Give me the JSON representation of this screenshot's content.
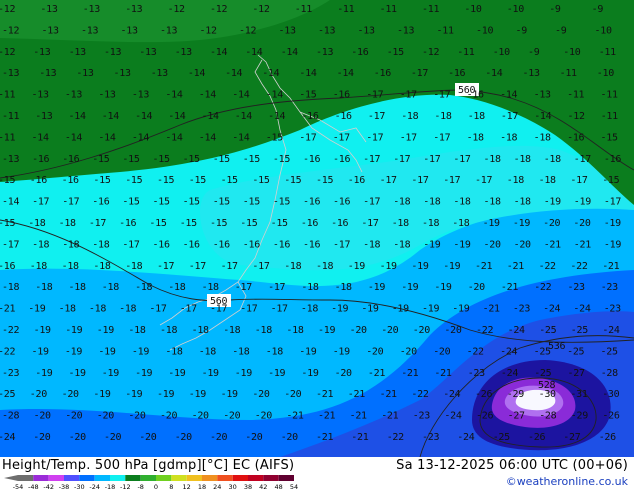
{
  "map": {
    "colors": {
      "dark_green": "#0b7d1e",
      "mid_green": "#168c2a",
      "cyan": "#10f0f0",
      "light_cyan": "#20e8f0",
      "sky": "#00b8ff",
      "blue": "#0070ff",
      "mid_blue": "#1e50e6",
      "navy": "#1c14a0",
      "violet": "#8a2bd8",
      "lilac": "#b070f0",
      "white": "#f8f8ff",
      "coast": "#d0d0d0"
    },
    "contour_labels": [
      "560",
      "560",
      "536",
      "528"
    ],
    "temperature_labels": [
      "-12",
      "-13",
      "-13",
      "-13",
      "-12",
      "-12",
      "-12",
      "-11",
      "-11",
      "-11",
      "-11",
      "-10",
      "-10",
      "-9",
      "-9",
      "-12",
      "-13",
      "-13",
      "-13",
      "-13",
      "-12",
      "-12",
      "-13",
      "-13",
      "-13",
      "-13",
      "-11",
      "-10",
      "-9",
      "-9",
      "-10",
      "-12",
      "-13",
      "-13",
      "-13",
      "-13",
      "-13",
      "-14",
      "-14",
      "-14",
      "-13",
      "-16",
      "-15",
      "-12",
      "-11",
      "-10",
      "-9",
      "-10",
      "-11",
      "-13",
      "-13",
      "-13",
      "-13",
      "-13",
      "-14",
      "-14",
      "-14",
      "-14",
      "-14",
      "-16",
      "-17",
      "-16",
      "-14",
      "-13",
      "-11",
      "-10",
      "-11",
      "-13",
      "-13",
      "-13",
      "-13",
      "-14",
      "-14",
      "-14",
      "-14",
      "-15",
      "-16",
      "-17",
      "-17",
      "-17",
      "-16",
      "-14",
      "-13",
      "-11",
      "-11",
      "-11",
      "-13",
      "-14",
      "-14",
      "-14",
      "-14",
      "-14",
      "-14",
      "-14",
      "-16",
      "-16",
      "-17",
      "-18",
      "-18",
      "-18",
      "-17",
      "-14",
      "-12",
      "-11",
      "-11",
      "-14",
      "-14",
      "-14",
      "-14",
      "-14",
      "-14",
      "-14",
      "-15",
      "-17",
      "-17",
      "-17",
      "-17",
      "-17",
      "-18",
      "-18",
      "-18",
      "-16",
      "-15",
      "-13",
      "-16",
      "-16",
      "-15",
      "-15",
      "-15",
      "-15",
      "-15",
      "-15",
      "-15",
      "-16",
      "-16",
      "-17",
      "-17",
      "-17",
      "-17",
      "-18",
      "-18",
      "-18",
      "-17",
      "-16",
      "-15",
      "-16",
      "-16",
      "-15",
      "-15",
      "-15",
      "-15",
      "-15",
      "-15",
      "-15",
      "-15",
      "-16",
      "-17",
      "-17",
      "-17",
      "-17",
      "-18",
      "-18",
      "-17",
      "-15",
      "-14",
      "-17",
      "-17",
      "-16",
      "-15",
      "-15",
      "-15",
      "-15",
      "-15",
      "-15",
      "-16",
      "-16",
      "-17",
      "-18",
      "-18",
      "-18",
      "-18",
      "-18",
      "-19",
      "-19",
      "-17",
      "-15",
      "-18",
      "-18",
      "-17",
      "-16",
      "-15",
      "-15",
      "-15",
      "-15",
      "-15",
      "-16",
      "-16",
      "-17",
      "-18",
      "-18",
      "-18",
      "-19",
      "-19",
      "-20",
      "-20",
      "-19",
      "-17",
      "-18",
      "-18",
      "-18",
      "-17",
      "-16",
      "-16",
      "-16",
      "-16",
      "-16",
      "-16",
      "-17",
      "-18",
      "-18",
      "-19",
      "-19",
      "-20",
      "-20",
      "-21",
      "-21",
      "-19",
      "-16",
      "-18",
      "-18",
      "-18",
      "-18",
      "-17",
      "-17",
      "-17",
      "-17",
      "-18",
      "-18",
      "-19",
      "-19",
      "-19",
      "-19",
      "-21",
      "-21",
      "-22",
      "-22",
      "-21",
      "-18",
      "-18",
      "-18",
      "-18",
      "-18",
      "-18",
      "-18",
      "-17",
      "-17",
      "-18",
      "-18",
      "-19",
      "-19",
      "-19",
      "-20",
      "-21",
      "-22",
      "-23",
      "-23",
      "-21",
      "-19",
      "-18",
      "-18",
      "-18",
      "-17",
      "-17",
      "-17",
      "-17",
      "-17",
      "-18",
      "-19",
      "-19",
      "-19",
      "-19",
      "-19",
      "-21",
      "-23",
      "-24",
      "-24",
      "-23",
      "-22",
      "-19",
      "-19",
      "-19",
      "-18",
      "-18",
      "-18",
      "-18",
      "-18",
      "-18",
      "-19",
      "-20",
      "-20",
      "-20",
      "-20",
      "-22",
      "-24",
      "-25",
      "-25",
      "-24",
      "-22",
      "-19",
      "-19",
      "-19",
      "-19",
      "-18",
      "-18",
      "-18",
      "-18",
      "-19",
      "-19",
      "-20",
      "-20",
      "-20",
      "-22",
      "-24",
      "-25",
      "-25",
      "-25",
      "-23",
      "-19",
      "-19",
      "-19",
      "-19",
      "-19",
      "-19",
      "-19",
      "-19",
      "-19",
      "-20",
      "-21",
      "-21",
      "-21",
      "-23",
      "-24",
      "-25",
      "-27",
      "-28",
      "-25",
      "-20",
      "-20",
      "-19",
      "-19",
      "-19",
      "-19",
      "-19",
      "-20",
      "-20",
      "-21",
      "-21",
      "-21",
      "-22",
      "-24",
      "-26",
      "-29",
      "-30",
      "-31",
      "-30",
      "-28",
      "-20",
      "-20",
      "-20",
      "-20",
      "-20",
      "-20",
      "-20",
      "-20",
      "-21",
      "-21",
      "-21",
      "-21",
      "-23",
      "-24",
      "-26",
      "-27",
      "-28",
      "-29",
      "-26",
      "-24",
      "-20",
      "-20",
      "-20",
      "-20",
      "-20",
      "-20",
      "-20",
      "-20",
      "-21",
      "-21",
      "-22",
      "-23",
      "-24",
      "-25",
      "-26",
      "-27",
      "-26",
      "-25"
    ]
  },
  "footer": {
    "title_left": "Height/Temp. 500 hPa [gdmp][°C] EC (AIFS)",
    "title_right": "Sa 13-12-2025 06:00 UTC (00+06)",
    "credit": "©weatheronline.co.uk",
    "scale_ticks": [
      "-54",
      "-48",
      "-42",
      "-38",
      "-30",
      "-24",
      "-18",
      "-12",
      "-8",
      "0",
      "8",
      "12",
      "18",
      "24",
      "30",
      "38",
      "42",
      "48",
      "54"
    ],
    "scale_colors": [
      "#6e6e6e",
      "#9b2bd8",
      "#d040f0",
      "#5050ff",
      "#0070ff",
      "#00b8ff",
      "#10f0f0",
      "#0b7d1e",
      "#30b030",
      "#70d020",
      "#d0e020",
      "#f0c020",
      "#f09020",
      "#f05020",
      "#e01010",
      "#c00020",
      "#900030",
      "#600030"
    ]
  }
}
